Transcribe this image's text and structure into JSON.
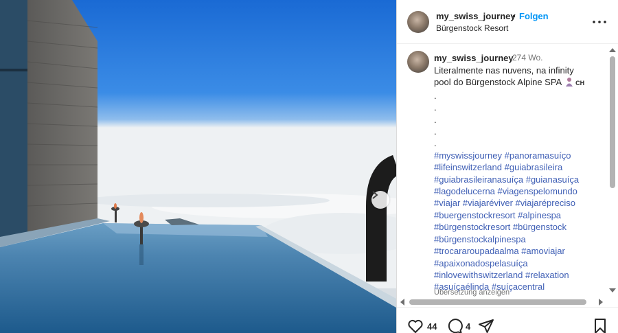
{
  "post": {
    "username": "my_swiss_journey",
    "separator": "•",
    "follow_label": "Folgen",
    "location": "Bürgenstock Resort"
  },
  "caption": {
    "username": "my_swiss_journey",
    "time": "274 Wo.",
    "text_line1": "Literalmente nas nuvens, na infinity",
    "text_line2": "pool do Bürgenstock Alpine SPA",
    "flag_code": "CH",
    "dots": [
      ".",
      ".",
      ".",
      ".",
      "."
    ],
    "hashtag_lines": [
      [
        "#myswissjourney",
        "#panoramasuíço"
      ],
      [
        "#lifeinswitzerland",
        "#guiabrasileira"
      ],
      [
        "#guiabrasileiranasuíça",
        "#guianasuíça"
      ],
      [
        "#lagodelucerna",
        "#viagenspelomundo"
      ],
      [
        "#viajar",
        "#viajaréviver",
        "#viajarépreciso"
      ],
      [
        "#buergenstockresort",
        "#alpinespa"
      ],
      [
        "#bürgenstockresort",
        "#bürgenstock"
      ],
      [
        "#bürgenstockalpinespa"
      ],
      [
        "#trocararoupadaalma",
        "#amoviajar"
      ],
      [
        "#apaixonadospelasuíça"
      ],
      [
        "#inlovewithswitzerland",
        "#relaxation"
      ],
      [
        "#asuíçaélinda",
        "#suíçacentral"
      ]
    ],
    "translate_label": "Übersetzung anzeigen"
  },
  "actions": {
    "likes": "44",
    "comments": "4"
  },
  "icons": {
    "more": "more-horizontal-icon",
    "like": "heart-icon",
    "comment": "comment-icon",
    "share": "share-icon",
    "save": "bookmark-icon",
    "next": "chevron-right-icon"
  },
  "colors": {
    "link": "#0095f6",
    "hashtag": "#3f5fb5",
    "muted": "#737373",
    "text": "#262626"
  }
}
